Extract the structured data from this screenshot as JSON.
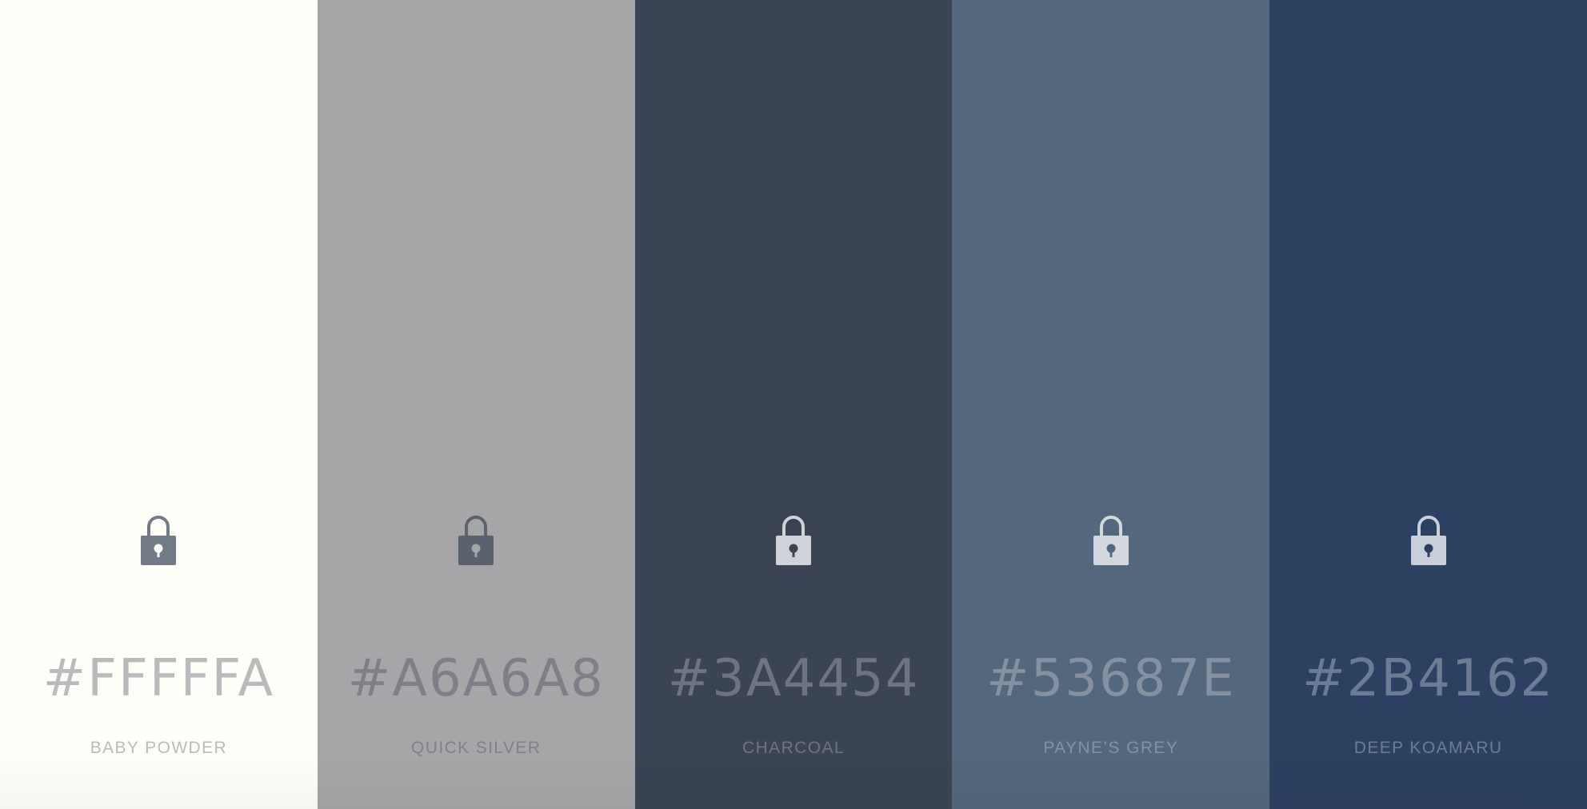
{
  "palette": {
    "swatches": [
      {
        "hex": "#FFFFFA",
        "name": "BABY POWDER",
        "background": "#FFFFFA",
        "text_color": "#B9BABC",
        "icon": "lock-icon",
        "lock_color": "#717A86",
        "keyhole_color": "#FFFFFA"
      },
      {
        "hex": "#A6A6A8",
        "name": "QUICK SILVER",
        "background": "#A6A6A8",
        "text_color": "#7E8089",
        "icon": "lock-icon",
        "lock_color": "#5A6270",
        "keyhole_color": "#A6A6A8"
      },
      {
        "hex": "#3A4454",
        "name": "CHARCOAL",
        "background": "#3A4454",
        "text_color": "#6D7584",
        "icon": "lock-icon",
        "lock_color": "#CFD3DA",
        "keyhole_color": "#3A4454"
      },
      {
        "hex": "#53687E",
        "name": "PAYNE’S GREY",
        "background": "#53687E",
        "text_color": "#8391A2",
        "icon": "lock-icon",
        "lock_color": "#D3D8DF",
        "keyhole_color": "#53687E"
      },
      {
        "hex": "#2B4162",
        "name": "DEEP KOAMARU",
        "background": "#2B4162",
        "text_color": "#6B7C95",
        "icon": "lock-icon",
        "lock_color": "#C9CFD9",
        "keyhole_color": "#2B4162"
      }
    ]
  }
}
